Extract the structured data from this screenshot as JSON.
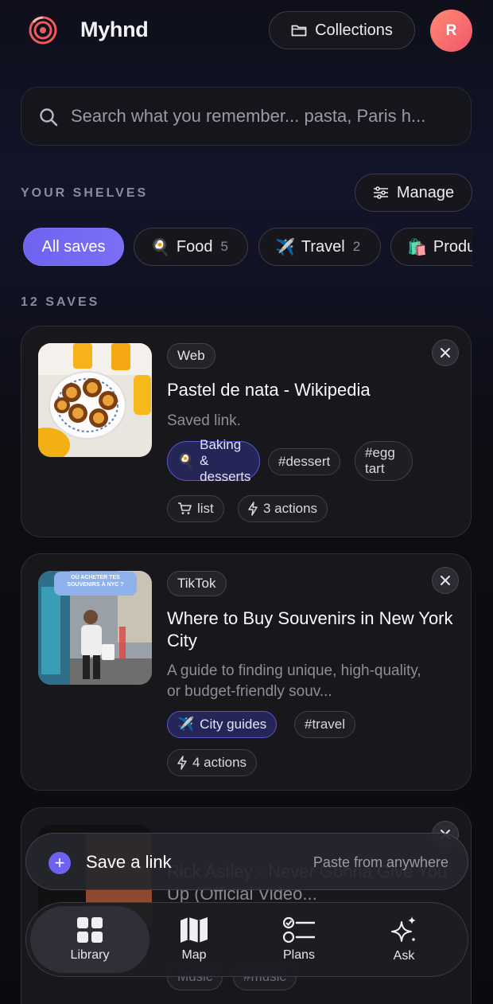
{
  "header": {
    "brand": "Myhnd",
    "collections_label": "Collections",
    "avatar_initial": "R"
  },
  "search": {
    "placeholder": "Search what you remember... pasta, Paris h..."
  },
  "shelves": {
    "section_label": "YOUR SHELVES",
    "manage_label": "Manage",
    "chips": [
      {
        "emoji": "",
        "label": "All saves",
        "count": "",
        "active": true
      },
      {
        "emoji": "🍳",
        "label": "Food",
        "count": "5"
      },
      {
        "emoji": "✈️",
        "label": "Travel",
        "count": "2"
      },
      {
        "emoji": "🛍️",
        "label": "Produ",
        "count": ""
      }
    ]
  },
  "saves": {
    "count_label": "12 SAVES",
    "cards": [
      {
        "source": "Web",
        "title": "Pastel de nata - Wikipedia",
        "desc": "Saved link.",
        "shelf_emoji": "🍳",
        "shelf_label": "Baking & desserts",
        "tags": [
          "#dessert",
          "#egg tart"
        ],
        "actions": [
          {
            "icon": "cart-icon",
            "label": "list"
          },
          {
            "icon": "lightning-icon",
            "label": "3 actions"
          }
        ]
      },
      {
        "source": "TikTok",
        "title": "Where to Buy Souvenirs in New York City",
        "desc": "A guide to finding unique, high-quality, or budget-friendly souv...",
        "shelf_emoji": "✈️",
        "shelf_label": "City guides",
        "tags": [
          "#travel"
        ],
        "thumb_caption": "OÙ ACHETER TES SOUVENIRS À NYC ?",
        "actions": [
          {
            "icon": "lightning-icon",
            "label": "4 actions"
          }
        ]
      },
      {
        "title": "Rick Astley - Never Gonna Give You Up (Official Video...",
        "tags": [
          "Music",
          "#music"
        ]
      }
    ]
  },
  "save_bar": {
    "label": "Save a link",
    "hint": "Paste from anywhere"
  },
  "tabs": [
    {
      "label": "Library",
      "icon": "grid-icon",
      "active": true
    },
    {
      "label": "Map",
      "icon": "map-icon"
    },
    {
      "label": "Plans",
      "icon": "checklist-icon"
    },
    {
      "label": "Ask",
      "icon": "sparkles-icon"
    }
  ],
  "colors": {
    "accent": "#6d63f0",
    "avatar": "#f46a6e",
    "background": "#0c0c12"
  }
}
